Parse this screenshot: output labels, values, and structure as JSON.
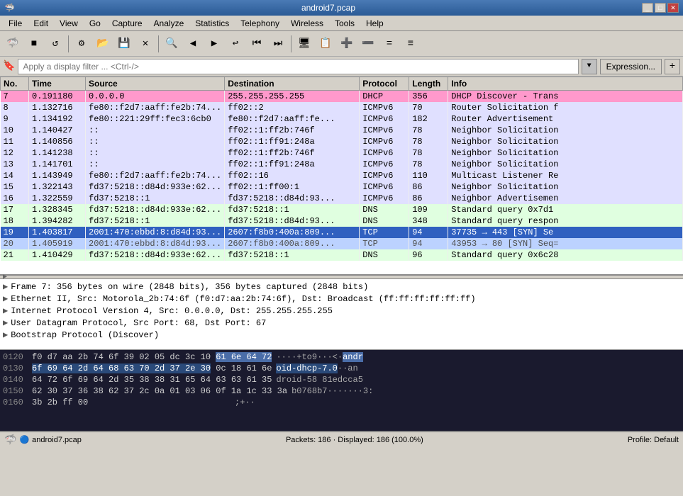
{
  "titlebar": {
    "title": "android7.pcap",
    "controls": [
      "_",
      "□",
      "✕"
    ]
  },
  "menubar": {
    "items": [
      "File",
      "Edit",
      "View",
      "Go",
      "Capture",
      "Analyze",
      "Statistics",
      "Telephony",
      "Wireless",
      "Tools",
      "Help"
    ]
  },
  "toolbar": {
    "buttons": [
      "🦈",
      "■",
      "↺",
      "⚙",
      "📂",
      "💾",
      "✕",
      "🔍",
      "◀",
      "▶",
      "↩",
      "⏮",
      "⏭",
      "🖥",
      "📋",
      "➕",
      "➖",
      "=",
      "≡"
    ]
  },
  "filterbar": {
    "placeholder": "Apply a display filter ... <Ctrl-/>",
    "expression_btn": "Expression...",
    "plus_btn": "+"
  },
  "columns": [
    "No.",
    "Time",
    "Source",
    "Destination",
    "Protocol",
    "Length",
    "Info"
  ],
  "packets": [
    {
      "no": "7",
      "time": "0.191180",
      "source": "0.0.0.0",
      "dest": "255.255.255.255",
      "proto": "DHCP",
      "len": "356",
      "info": "DHCP Discover - Trans",
      "class": "row-dhcp",
      "selected": false
    },
    {
      "no": "8",
      "time": "1.132716",
      "source": "fe80::f2d7:aaff:fe2b:74...",
      "dest": "ff02::2",
      "proto": "ICMPv6",
      "len": "70",
      "info": "Router Solicitation f",
      "class": "row-icmpv6",
      "selected": false
    },
    {
      "no": "9",
      "time": "1.134192",
      "source": "fe80::221:29ff:fec3:6cb0",
      "dest": "fe80::f2d7:aaff:fe...",
      "proto": "ICMPv6",
      "len": "182",
      "info": "Router Advertisement",
      "class": "row-icmpv6",
      "selected": false
    },
    {
      "no": "10",
      "time": "1.140427",
      "source": "::",
      "dest": "ff02::1:ff2b:746f",
      "proto": "ICMPv6",
      "len": "78",
      "info": "Neighbor Solicitation",
      "class": "row-icmpv6",
      "selected": false
    },
    {
      "no": "11",
      "time": "1.140856",
      "source": "::",
      "dest": "ff02::1:ff91:248a",
      "proto": "ICMPv6",
      "len": "78",
      "info": "Neighbor Solicitation",
      "class": "row-icmpv6",
      "selected": false
    },
    {
      "no": "12",
      "time": "1.141238",
      "source": "::",
      "dest": "ff02::1:ff2b:746f",
      "proto": "ICMPv6",
      "len": "78",
      "info": "Neighbor Solicitation",
      "class": "row-icmpv6",
      "selected": false
    },
    {
      "no": "13",
      "time": "1.141701",
      "source": "::",
      "dest": "ff02::1:ff91:248a",
      "proto": "ICMPv6",
      "len": "78",
      "info": "Neighbor Solicitation",
      "class": "row-icmpv6",
      "selected": false
    },
    {
      "no": "14",
      "time": "1.143949",
      "source": "fe80::f2d7:aaff:fe2b:74...",
      "dest": "ff02::16",
      "proto": "ICMPv6",
      "len": "110",
      "info": "Multicast Listener Re",
      "class": "row-icmpv6",
      "selected": false
    },
    {
      "no": "15",
      "time": "1.322143",
      "source": "fd37:5218::d84d:933e:62...",
      "dest": "ff02::1:ff00:1",
      "proto": "ICMPv6",
      "len": "86",
      "info": "Neighbor Solicitation",
      "class": "row-icmpv6",
      "selected": false
    },
    {
      "no": "16",
      "time": "1.322559",
      "source": "fd37:5218::1",
      "dest": "fd37:5218::d84d:93...",
      "proto": "ICMPv6",
      "len": "86",
      "info": "Neighbor Advertisemen",
      "class": "row-icmpv6",
      "selected": false
    },
    {
      "no": "17",
      "time": "1.328345",
      "source": "fd37:5218::d84d:933e:62...",
      "dest": "fd37:5218::1",
      "proto": "DNS",
      "len": "109",
      "info": "Standard query 0x7d1",
      "class": "row-dns",
      "selected": false
    },
    {
      "no": "18",
      "time": "1.394282",
      "source": "fd37:5218::1",
      "dest": "fd37:5218::d84d:93...",
      "proto": "DNS",
      "len": "348",
      "info": "Standard query respon",
      "class": "row-dns",
      "selected": false
    },
    {
      "no": "19",
      "time": "1.403817",
      "source": "2001:470:ebbd:8:d84d:93...",
      "dest": "2607:f8b0:400a:809...",
      "proto": "TCP",
      "len": "94",
      "info": "37735 → 443 [SYN] Se",
      "class": "row-tcp-selected",
      "selected": true
    },
    {
      "no": "20",
      "time": "1.405919",
      "source": "2001:470:ebbd:8:d84d:93...",
      "dest": "2607:f8b0:400a:809...",
      "proto": "TCP",
      "len": "94",
      "info": "43953 → 80 [SYN] Seq=",
      "class": "row-tcp",
      "selected": false
    },
    {
      "no": "21",
      "time": "1.410429",
      "source": "fd37:5218::d84d:933e:62...",
      "dest": "fd37:5218::1",
      "proto": "DNS",
      "len": "96",
      "info": "Standard query 0x6c28",
      "class": "row-dns",
      "selected": false
    }
  ],
  "details": [
    "Frame 7: 356 bytes on wire (2848 bits), 356 bytes captured (2848 bits)",
    "Ethernet II, Src: Motorola_2b:74:6f (f0:d7:aa:2b:74:6f), Dst: Broadcast (ff:ff:ff:ff:ff:ff)",
    "Internet Protocol Version 4, Src: 0.0.0.0, Dst: 255.255.255.255",
    "User Datagram Protocol, Src Port: 68, Dst Port: 67",
    "Bootstrap Protocol (Discover)"
  ],
  "hex": [
    {
      "offset": "0120",
      "bytes": "f0 d7 aa 2b 74 6f 39 02  05 dc 3c 10",
      "ascii": "···+to9···<·",
      "highlight1": "61 6e 64 72",
      "ascii1": "·to9··<-",
      "hl1_ascii": "andr"
    },
    {
      "offset": "0130",
      "bytes_hl": "6f 69 64 2d 64 68 63 70  2d 37 2e 30",
      "bytes_rest": "0c 18 61 6e",
      "ascii_hl": "oid-dhcp-7.0",
      "ascii_rest": "··an"
    },
    {
      "offset": "0140",
      "bytes": "64 72 6f 69 64 2d 35 38  38 31 65 64 63 63 61 35",
      "ascii": "droid-58  81edcca5"
    },
    {
      "offset": "0150",
      "bytes": "62 30 37 36 38 62 37 2c  0a 01 03 06 0f 1a 1c 33 3a",
      "ascii": "b0768b7·······3:"
    },
    {
      "offset": "0160",
      "bytes": "3b 2b ff 00",
      "ascii": ";+··"
    }
  ],
  "statusbar": {
    "filename": "android7.pcap",
    "packets_info": "Packets: 186 · Displayed: 186 (100.0%)",
    "profile": "Profile: Default"
  }
}
